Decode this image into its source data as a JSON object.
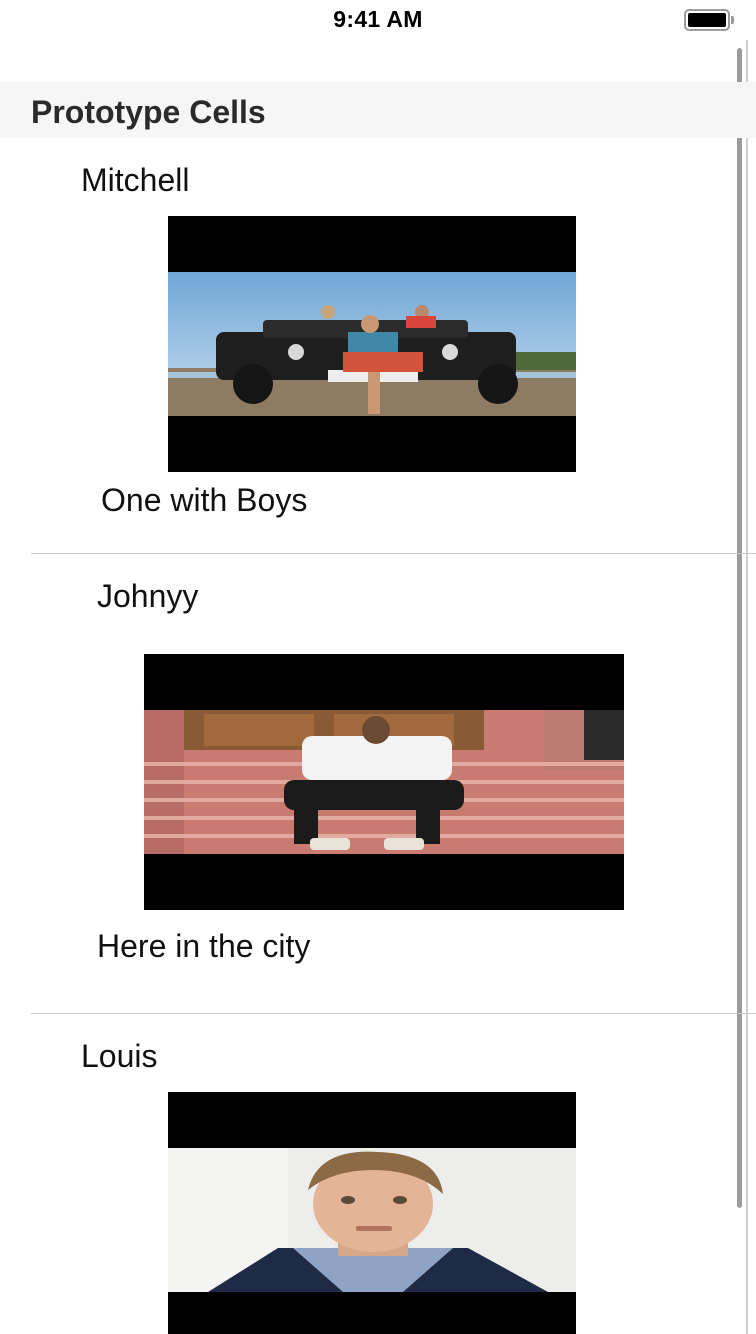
{
  "status_bar": {
    "time": "9:41 AM"
  },
  "section": {
    "title": "Prototype Cells"
  },
  "cells": [
    {
      "name": "Mitchell",
      "caption": "One with Boys"
    },
    {
      "name": "Johnyy",
      "caption": "Here in the city"
    },
    {
      "name": "Louis",
      "caption": ""
    }
  ],
  "colors": {
    "section_header_bg": "#f6f6f6",
    "separator": "#c8c7cc",
    "photo_letterbox": "#000000"
  }
}
